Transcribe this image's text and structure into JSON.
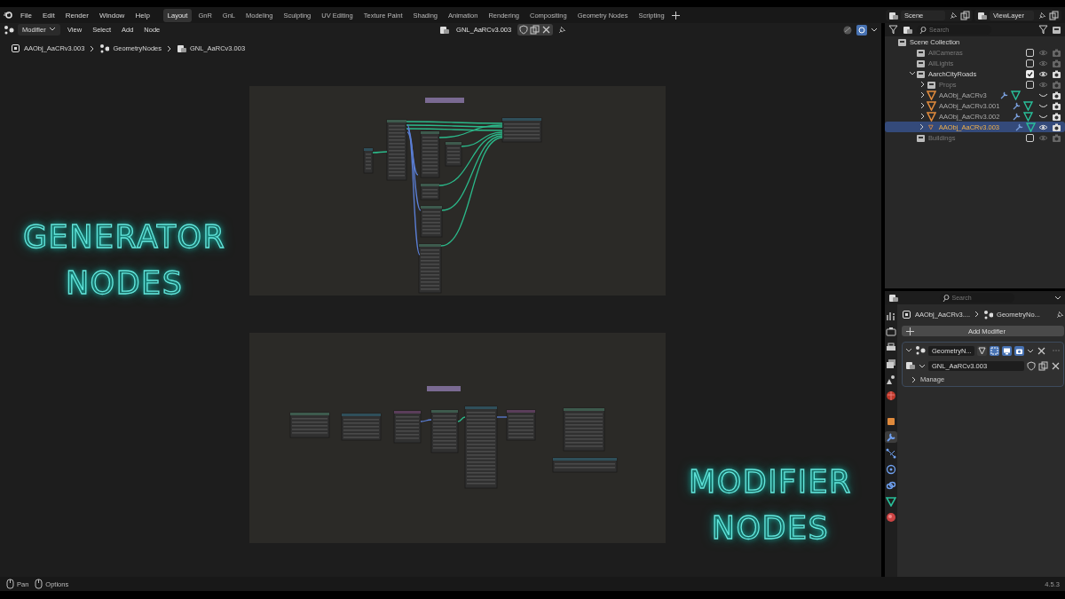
{
  "menu": [
    "File",
    "Edit",
    "Render",
    "Window",
    "Help"
  ],
  "workspaces": [
    {
      "label": "Layout",
      "selected": true
    },
    {
      "label": "GnR",
      "selected": false
    },
    {
      "label": "GnL",
      "selected": false
    },
    {
      "label": "Modeling",
      "selected": false
    },
    {
      "label": "Sculpting",
      "selected": false
    },
    {
      "label": "UV Editing",
      "selected": false
    },
    {
      "label": "Texture Paint",
      "selected": false
    },
    {
      "label": "Shading",
      "selected": false
    },
    {
      "label": "Animation",
      "selected": false
    },
    {
      "label": "Rendering",
      "selected": false
    },
    {
      "label": "Compositing",
      "selected": false
    },
    {
      "label": "Geometry Nodes",
      "selected": false
    },
    {
      "label": "Scripting",
      "selected": false
    }
  ],
  "scene": {
    "name": "Scene"
  },
  "view_layer": {
    "name": "ViewLayer"
  },
  "node_editor": {
    "mode": "Modifier",
    "menus": [
      "View",
      "Select",
      "Add",
      "Node"
    ],
    "node_group": "GNL_AaRCv3.003",
    "breadcrumb": [
      "AAObj_AaCRv3.003",
      "GeometryNodes",
      "GNL_AaRCv3.003"
    ],
    "overlay_texts": [
      {
        "lines": [
          "GENERATOR",
          "NODES"
        ]
      },
      {
        "lines": [
          "MODIFIER",
          "NODES"
        ]
      }
    ]
  },
  "outliner": {
    "search": {
      "placeholder": "Search"
    },
    "tree": {
      "name": "Scene Collection",
      "children": [
        {
          "name": "AllCameras",
          "kind": "collection",
          "checked": false,
          "visible": true,
          "selected": false
        },
        {
          "name": "AllLights",
          "kind": "collection",
          "checked": false,
          "visible": true,
          "selected": false
        },
        {
          "name": "AarchCityRoads",
          "kind": "collection",
          "checked": true,
          "visible": true,
          "selected": false,
          "expanded": true,
          "children": [
            {
              "name": "Props",
              "kind": "collection",
              "checked": false,
              "visible": true,
              "selected": false,
              "expanded": false
            },
            {
              "name": "AAObj_AaCRv3",
              "kind": "object",
              "visible": false,
              "selected": false,
              "expanded": false
            },
            {
              "name": "AAObj_AaCRv3.001",
              "kind": "object",
              "visible": false,
              "selected": false,
              "expanded": false
            },
            {
              "name": "AAObj_AaCRv3.002",
              "kind": "object",
              "visible": false,
              "selected": false,
              "expanded": false
            },
            {
              "name": "AAObj_AaCRv3.003",
              "kind": "object",
              "visible": true,
              "selected": true,
              "expanded": false
            }
          ]
        },
        {
          "name": "Buildings",
          "kind": "collection",
          "checked": false,
          "visible": true,
          "selected": false
        }
      ]
    }
  },
  "properties": {
    "search": {
      "placeholder": "Search"
    },
    "tabs": [
      {
        "kind": "tool",
        "selected": false
      },
      {
        "kind": "render",
        "selected": false
      },
      {
        "kind": "output",
        "selected": false
      },
      {
        "kind": "view_layer",
        "selected": false
      },
      {
        "kind": "scene",
        "selected": false
      },
      {
        "kind": "world",
        "selected": false
      },
      {
        "kind": "object",
        "selected": false
      },
      {
        "kind": "modifier",
        "selected": true
      },
      {
        "kind": "particles",
        "selected": false
      },
      {
        "kind": "physics",
        "selected": false
      },
      {
        "kind": "constraints",
        "selected": false
      },
      {
        "kind": "data",
        "selected": false
      },
      {
        "kind": "material",
        "selected": false
      }
    ],
    "breadcrumb": [
      "AAObj_AaCRv3....",
      "GeometryNo..."
    ],
    "add_button": "Add Modifier",
    "modifier": {
      "name": "GeometryN...",
      "expanded": true,
      "toggles": [
        {
          "kind": "editmode",
          "on": false
        },
        {
          "kind": "cage",
          "on": true
        },
        {
          "kind": "viewport",
          "on": true
        },
        {
          "kind": "render",
          "on": true
        }
      ],
      "node_group": "GNL_AaRCv3.003",
      "sections": [
        {
          "label": "Manage",
          "expanded": false
        }
      ]
    }
  },
  "status_bar": {
    "hints": [
      {
        "label": "Pan"
      },
      {
        "label": "Options"
      }
    ],
    "version": "4.5.3"
  }
}
